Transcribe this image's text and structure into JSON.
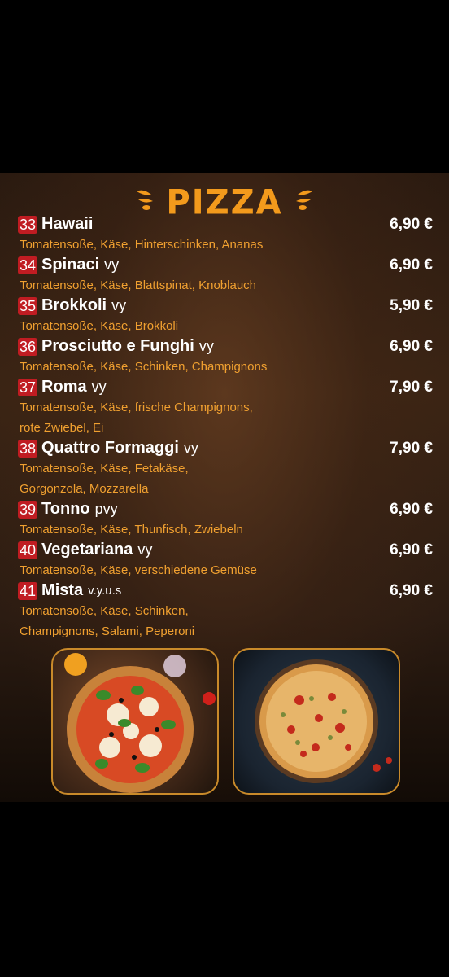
{
  "menu": {
    "title": "PIZZA",
    "items": [
      {
        "num": "33",
        "name": "Hawaii",
        "suffix": "",
        "price": "6,90 €",
        "desc": [
          "Tomatensoße, Käse, Hinterschinken, Ananas"
        ]
      },
      {
        "num": "34",
        "name": "Spinaci",
        "suffix": "vy",
        "price": "6,90 €",
        "desc": [
          "Tomatensoße, Käse, Blattspinat, Knoblauch"
        ]
      },
      {
        "num": "35",
        "name": "Brokkoli",
        "suffix": "vy",
        "price": "5,90 €",
        "desc": [
          "Tomatensoße, Käse, Brokkoli"
        ]
      },
      {
        "num": "36",
        "name": "Prosciutto e Funghi",
        "suffix": "vy",
        "price": "6,90 €",
        "desc": [
          "Tomatensoße, Käse, Schinken, Champignons"
        ]
      },
      {
        "num": "37",
        "name": "Roma",
        "suffix": "vy",
        "price": "7,90 €",
        "desc": [
          "Tomatensoße, Käse, frische Champignons,",
          "rote Zwiebel, Ei"
        ]
      },
      {
        "num": "38",
        "name": "Quattro Formaggi",
        "suffix": "vy",
        "price": "7,90 €",
        "desc": [
          "Tomatensoße, Käse, Fetakäse,",
          "Gorgonzola, Mozzarella"
        ]
      },
      {
        "num": "39",
        "name": "Tonno",
        "suffix": "pvy",
        "price": "6,90 €",
        "desc": [
          "Tomatensoße, Käse, Thunfisch, Zwiebeln"
        ]
      },
      {
        "num": "40",
        "name": "Vegetariana",
        "suffix": "vy",
        "price": "6,90 €",
        "desc": [
          "Tomatensoße, Käse, verschiedene Gemüse"
        ]
      },
      {
        "num": "41",
        "name": "Mista",
        "suffix": "v.y.u.s",
        "price": "6,90 €",
        "desc": [
          "Tomatensoße, Käse, Schinken,",
          "Champignons, Salami, Peperoni"
        ]
      }
    ]
  },
  "colors": {
    "accent": "#f39a1c",
    "badge": "#c01c22",
    "desc": "#f0a030"
  },
  "images": [
    "margherita-pizza-photo",
    "mixed-pizza-photo"
  ]
}
